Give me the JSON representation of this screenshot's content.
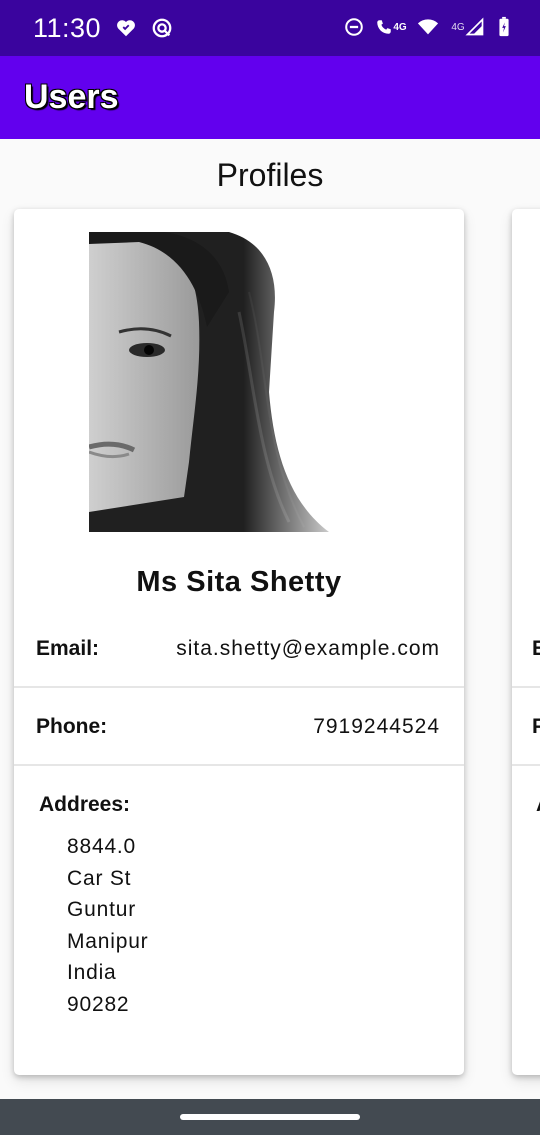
{
  "status_bar": {
    "time": "11:30",
    "left_icons": [
      "iheart-icon",
      "radio-app-icon"
    ],
    "right_icons": [
      "do-not-disturb-icon",
      "wifi-calling-icon",
      "wifi-icon",
      "signal-icon",
      "battery-charging-icon"
    ],
    "network_1": "4G",
    "network_2": "4G"
  },
  "app_bar": {
    "title": "Users"
  },
  "page": {
    "title": "Profiles"
  },
  "profile": {
    "name": "Ms Sita Shetty",
    "email_label": "Email:",
    "email": "sita.shetty@example.com",
    "phone_label": "Phone:",
    "phone": "7919244524",
    "address_label": "Addrees:",
    "address": {
      "number": "8844.0",
      "street": "Car St",
      "city": "Guntur",
      "state": "Manipur",
      "country": "India",
      "postcode": "90282"
    }
  },
  "peek_card": {
    "email_initial": "E",
    "phone_initial": "P",
    "address_initial": "A"
  },
  "colors": {
    "status_bar": "#3a049e",
    "app_bar": "#6200ee",
    "nav_bar": "#434a51"
  }
}
